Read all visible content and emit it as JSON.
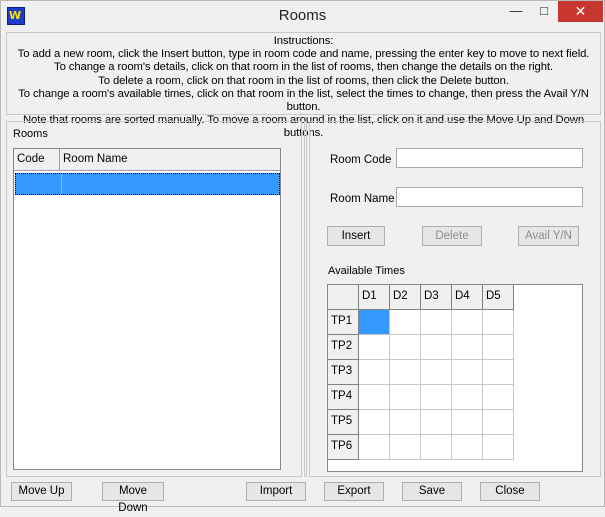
{
  "window": {
    "title": "Rooms",
    "app_icon_glyph": "W",
    "minimize_glyph": "—",
    "maximize_glyph": "□",
    "close_glyph": "✕"
  },
  "instructions": {
    "heading": "Instructions:",
    "lines": [
      "To add a new room, click the Insert button, type in room code and name, pressing the enter key to move to next field.",
      "To change a room's details, click on that room in the list of rooms, then change the details on the right.",
      "To delete a room, click on that room in the list of rooms, then click the Delete button.",
      "To change a room's available times, click on that room in the list, select the times to change, then press the Avail Y/N button.",
      "Note that rooms are sorted manually.  To move a room around in the list, click on it and use the Move Up and Down buttons."
    ]
  },
  "rooms_panel": {
    "label": "Rooms",
    "columns": [
      "Code",
      "Room Name"
    ],
    "rows": [
      {
        "code": "",
        "name": "",
        "selected": true
      }
    ]
  },
  "details": {
    "room_code_label": "Room Code",
    "room_code_value": "",
    "room_name_label": "Room Name",
    "room_name_value": "",
    "insert_label": "Insert",
    "delete_label": "Delete",
    "avail_label": "Avail Y/N",
    "available_times_label": "Available Times",
    "day_headers": [
      "D1",
      "D2",
      "D3",
      "D4",
      "D5"
    ],
    "period_headers": [
      "TP1",
      "TP2",
      "TP3",
      "TP4",
      "TP5",
      "TP6"
    ],
    "selected_cell": {
      "period": "TP1",
      "day": "D1"
    }
  },
  "bottom": {
    "move_up_label": "Move Up",
    "move_down_label": "Move Down",
    "import_label": "Import",
    "export_label": "Export",
    "save_label": "Save",
    "close_label": "Close"
  },
  "colors": {
    "selection": "#3399ff",
    "close_button": "#c7372f"
  }
}
